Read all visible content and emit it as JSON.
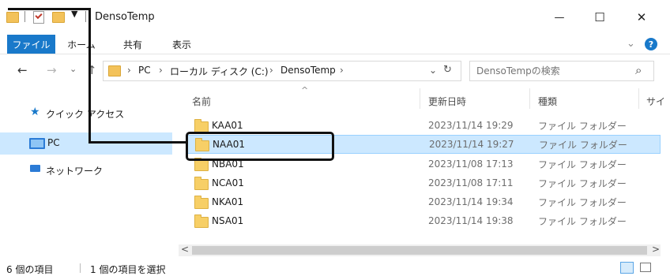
{
  "titlebar": {
    "title": "DensoTemp",
    "minimize": "—",
    "maximize": "☐",
    "close": "✕",
    "qa_menu_arrow": "▼"
  },
  "ribbon": {
    "tabs": [
      "ファイル",
      "ホーム",
      "共有",
      "表示"
    ],
    "expand": "⌄",
    "help": "?"
  },
  "nav": {
    "back": "←",
    "forward": "→",
    "recent": "⌄",
    "up": "↑",
    "breadcrumb": [
      "PC",
      "ローカル ディスク (C:)",
      "DensoTemp"
    ],
    "sep": "›",
    "dropdown": "⌄",
    "refresh": "↻",
    "search_placeholder": "DensoTempの検索",
    "search_icon": "⌕"
  },
  "sidebar": {
    "items": [
      {
        "label": "クイック アクセス",
        "icon": "star-icon"
      },
      {
        "label": "PC",
        "icon": "monitor-icon"
      },
      {
        "label": "ネットワーク",
        "icon": "network-icon"
      }
    ]
  },
  "columns": {
    "sort_arrow": "^",
    "name": "名前",
    "modified": "更新日時",
    "type": "種類",
    "size": "サイ"
  },
  "files": [
    {
      "name": "KAA01",
      "modified": "2023/11/14 19:29",
      "type": "ファイル フォルダー",
      "selected": false
    },
    {
      "name": "NAA01",
      "modified": "2023/11/14 19:27",
      "type": "ファイル フォルダー",
      "selected": true
    },
    {
      "name": "NBA01",
      "modified": "2023/11/08 17:13",
      "type": "ファイル フォルダー",
      "selected": false
    },
    {
      "name": "NCA01",
      "modified": "2023/11/08 17:11",
      "type": "ファイル フォルダー",
      "selected": false
    },
    {
      "name": "NKA01",
      "modified": "2023/11/14 19:34",
      "type": "ファイル フォルダー",
      "selected": false
    },
    {
      "name": "NSA01",
      "modified": "2023/11/14 19:38",
      "type": "ファイル フォルダー",
      "selected": false
    }
  ],
  "scroll": {
    "left": "<",
    "right": ">"
  },
  "status": {
    "count": "6 個の項目",
    "selected": "1 個の項目を選択"
  },
  "colors": {
    "accent": "#1979ca",
    "selection": "#cce8ff",
    "folder": "#f7cf66"
  }
}
